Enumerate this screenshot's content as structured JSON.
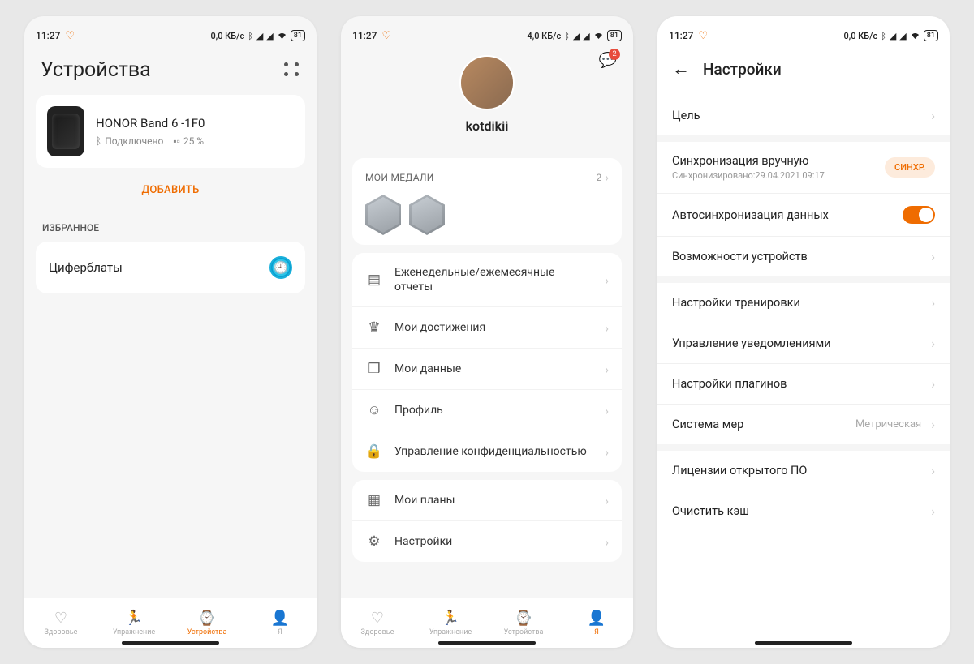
{
  "status": {
    "time": "11:27",
    "data_a": "0,0 КБ/с",
    "data_b": "4,0 КБ/с",
    "data_c": "0,0 КБ/с",
    "battery": "81"
  },
  "screen1": {
    "title": "Устройства",
    "device": {
      "name": "HONOR Band 6 -1F0",
      "status": "Подключено",
      "battery": "25 %"
    },
    "add": "ДОБАВИТЬ",
    "fav_header": "ИЗБРАННОЕ",
    "fav_item": "Циферблаты",
    "nav": [
      "Здоровье",
      "Упражнение",
      "Устройства",
      "Я"
    ]
  },
  "screen2": {
    "notif_count": "2",
    "username": "kotdikii",
    "medals_title": "МОИ МЕДАЛИ",
    "medals_count": "2",
    "items": [
      "Еженедельные/ежемесячные отчеты",
      "Мои достижения",
      "Мои данные",
      "Профиль",
      "Управление конфиденциальностью",
      "Мои планы",
      "Настройки"
    ],
    "nav": [
      "Здоровье",
      "Упражнение",
      "Устройства",
      "Я"
    ]
  },
  "screen3": {
    "title": "Настройки",
    "goal": "Цель",
    "sync_title": "Синхронизация вручную",
    "sync_sub": "Синхронизировано:29.04.2021 09:17",
    "sync_btn": "СИНХР.",
    "autosync": "Автосинхронизация данных",
    "capabilities": "Возможности устройств",
    "workout": "Настройки тренировки",
    "notif": "Управление уведомлениями",
    "plugins": "Настройки плагинов",
    "units": "Система мер",
    "units_val": "Метрическая",
    "license": "Лицензии открытого ПО",
    "cache": "Очистить кэш"
  }
}
